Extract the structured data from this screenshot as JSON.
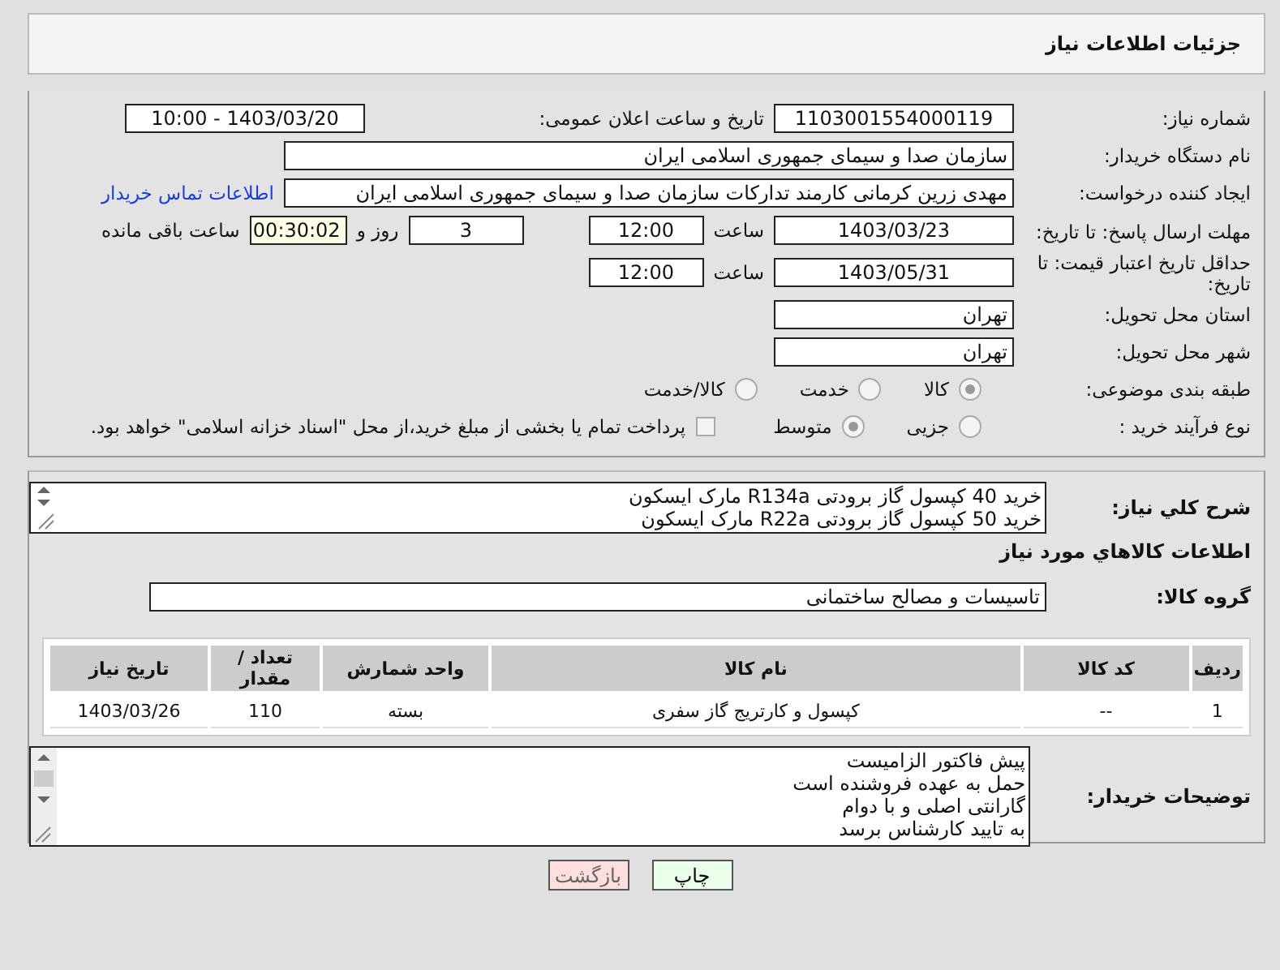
{
  "header": {
    "title": "جزئیات اطلاعات نیاز"
  },
  "fields": {
    "need_number": {
      "label": "شماره نیاز:",
      "value": "1103001554000119"
    },
    "announce": {
      "label": "تاریخ و ساعت اعلان عمومی:",
      "value": "1403/03/20 - 10:00"
    },
    "buyer": {
      "label": "نام دستگاه خریدار:",
      "value": "سازمان صدا و سیمای جمهوری اسلامی ایران"
    },
    "creator": {
      "label": "ایجاد کننده درخواست:",
      "value": "مهدی زرین کرمانی کارمند تدارکات سازمان صدا و سیمای جمهوری اسلامی ایران",
      "link": "اطلاعات تماس خریدار"
    },
    "deadline": {
      "label": "مهلت ارسال پاسخ: تا تاریخ:",
      "date": "1403/03/23",
      "time_label": "ساعت",
      "time": "12:00",
      "days": "3",
      "days_label": "روز و",
      "remaining": "00:30:02",
      "remaining_label": "ساعت باقی مانده"
    },
    "validity": {
      "label": "حداقل تاریخ اعتبار قیمت: تا تاریخ:",
      "date": "1403/05/31",
      "time_label": "ساعت",
      "time": "12:00"
    },
    "province": {
      "label": "استان محل تحویل:",
      "value": "تهران"
    },
    "city": {
      "label": "شهر محل تحویل:",
      "value": "تهران"
    },
    "category": {
      "label": "طبقه بندی موضوعی:",
      "options": [
        {
          "label": "کالا",
          "selected": true
        },
        {
          "label": "خدمت",
          "selected": false
        },
        {
          "label": "کالا/خدمت",
          "selected": false
        }
      ]
    },
    "process": {
      "label": "نوع فرآیند خرید :",
      "options": [
        {
          "label": "جزیی",
          "selected": false
        },
        {
          "label": "متوسط",
          "selected": true
        }
      ],
      "payment": {
        "label": "پرداخت تمام یا بخشی از مبلغ خرید،از محل \"اسناد خزانه اسلامی\" خواهد بود.",
        "checked": false
      }
    }
  },
  "description": {
    "label": "شرح کلي نياز:",
    "lines": [
      "خرید 40 کپسول گاز برودتی R134a مارک ایسکون",
      "خرید 50 کپسول گاز برودتی R22a مارک ایسکون"
    ]
  },
  "goods": {
    "title": "اطلاعات کالاهاي مورد نياز",
    "group_label": "گروه کالا:",
    "group": "تاسیسات و مصالح ساختمانی",
    "table": {
      "columns": [
        "ردیف",
        "کد کالا",
        "نام کالا",
        "واحد شمارش",
        "تعداد / مقدار",
        "تاریخ نیاز"
      ],
      "rows": [
        [
          "1",
          "--",
          "کپسول و کارتریج گاز سفری",
          "بسته",
          "110",
          "1403/03/26"
        ]
      ]
    }
  },
  "notes": {
    "label": "توضیحات خریدار:",
    "lines": [
      "پیش فاکتور الزامیست",
      "حمل به عهده فروشنده است",
      "گارانتی اصلی و با دوام",
      "به تایید کارشناس برسد"
    ]
  },
  "buttons": [
    {
      "label": "چاپ",
      "kind": "print"
    },
    {
      "label": "بازگشت",
      "kind": "back"
    }
  ]
}
